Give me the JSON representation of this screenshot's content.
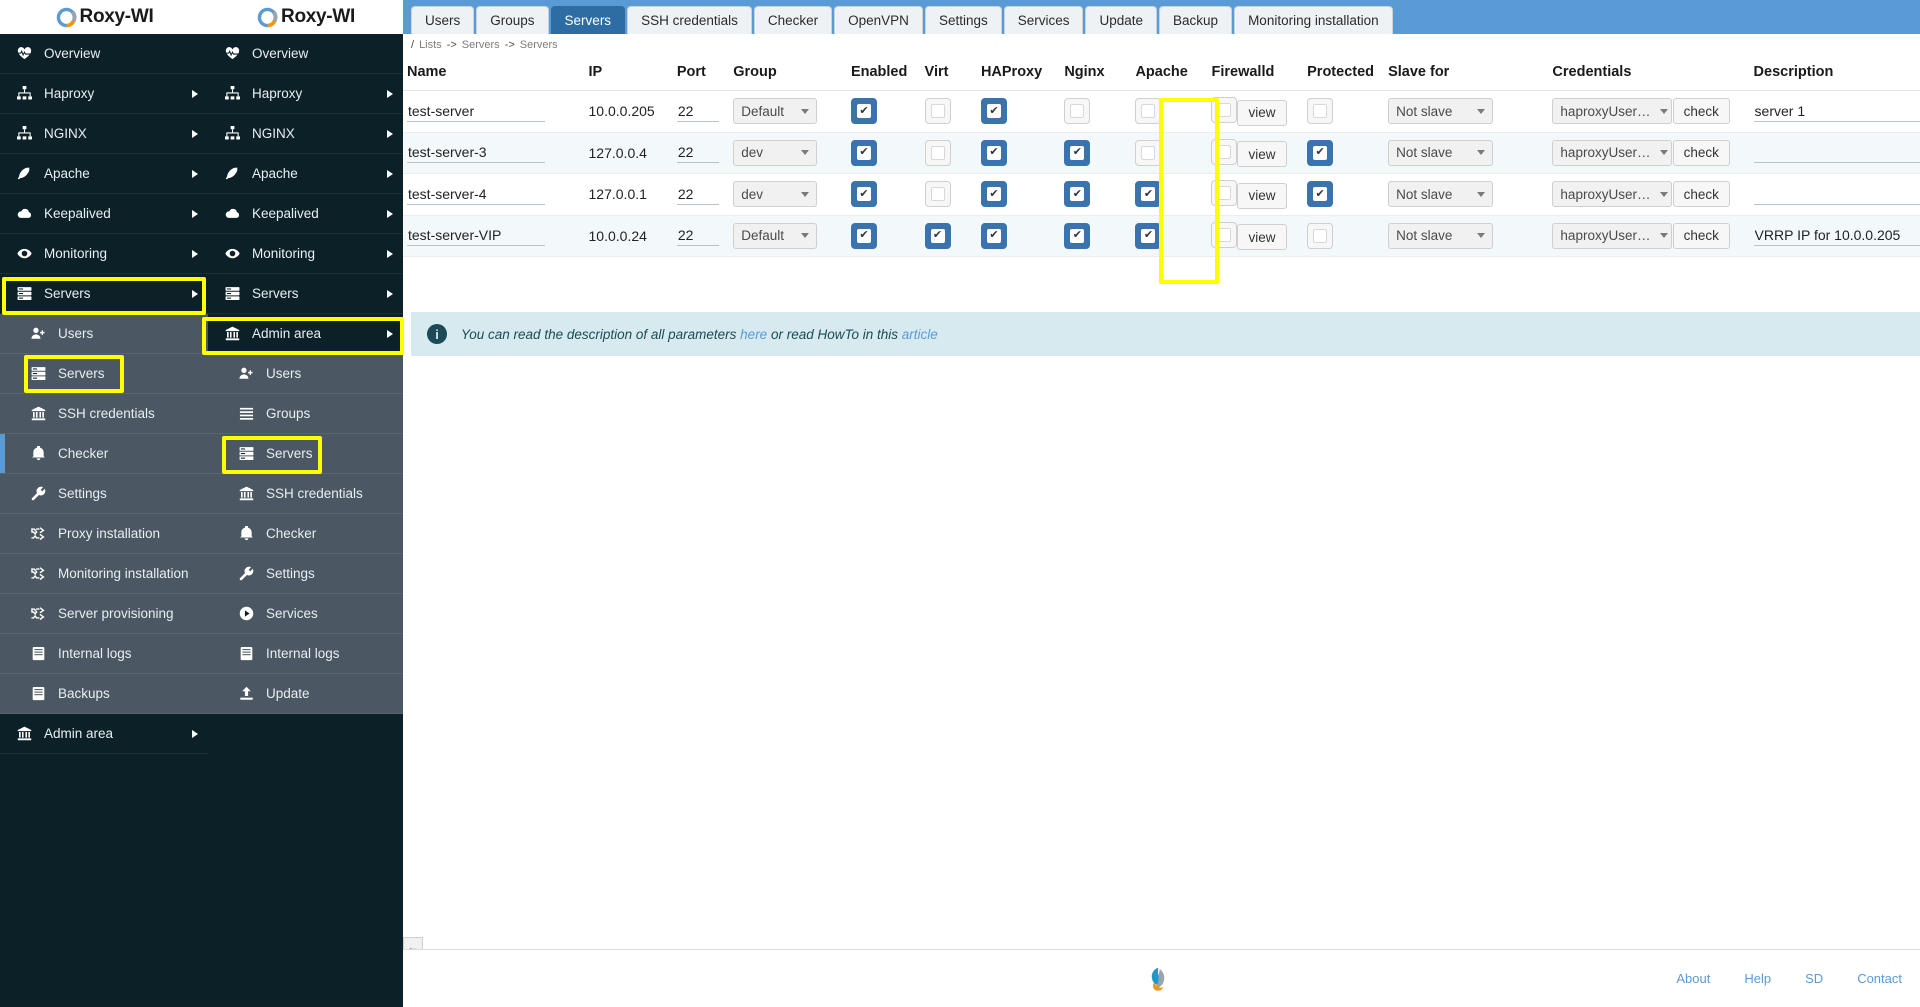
{
  "brand": {
    "name": "Roxy-WI"
  },
  "sidebar_primary": {
    "items": [
      {
        "label": "Overview",
        "icon": "heartbeat-icon",
        "expandable": false
      },
      {
        "label": "Haproxy",
        "icon": "sitemap-icon",
        "expandable": true
      },
      {
        "label": "NGINX",
        "icon": "sitemap-icon",
        "expandable": true
      },
      {
        "label": "Apache",
        "icon": "feather-icon",
        "expandable": true
      },
      {
        "label": "Keepalived",
        "icon": "cloud-icon",
        "expandable": true
      },
      {
        "label": "Monitoring",
        "icon": "eye-icon",
        "expandable": true
      },
      {
        "label": "Servers",
        "icon": "server-icon",
        "expandable": true,
        "highlighted": true
      }
    ],
    "sub_items": [
      {
        "label": "Users",
        "icon": "user-plus-icon"
      },
      {
        "label": "Servers",
        "icon": "server-icon",
        "highlighted": true
      },
      {
        "label": "SSH credentials",
        "icon": "bank-icon"
      },
      {
        "label": "Checker",
        "icon": "bell-icon",
        "active": true
      },
      {
        "label": "Settings",
        "icon": "wrench-icon"
      },
      {
        "label": "Proxy installation",
        "icon": "shuffle-icon"
      },
      {
        "label": "Monitoring installation",
        "icon": "shuffle-icon"
      },
      {
        "label": "Server provisioning",
        "icon": "shuffle-icon"
      },
      {
        "label": "Internal logs",
        "icon": "book-icon"
      },
      {
        "label": "Backups",
        "icon": "book-icon"
      }
    ],
    "trailing": [
      {
        "label": "Admin area",
        "icon": "bank-icon",
        "expandable": true
      }
    ]
  },
  "sidebar_secondary": {
    "items": [
      {
        "label": "Overview",
        "icon": "heartbeat-icon",
        "expandable": false
      },
      {
        "label": "Haproxy",
        "icon": "sitemap-icon",
        "expandable": true
      },
      {
        "label": "NGINX",
        "icon": "sitemap-icon",
        "expandable": true
      },
      {
        "label": "Apache",
        "icon": "feather-icon",
        "expandable": true
      },
      {
        "label": "Keepalived",
        "icon": "cloud-icon",
        "expandable": true
      },
      {
        "label": "Monitoring",
        "icon": "eye-icon",
        "expandable": true
      },
      {
        "label": "Servers",
        "icon": "server-icon",
        "expandable": true
      },
      {
        "label": "Admin area",
        "icon": "bank-icon",
        "expandable": true,
        "highlighted": true
      }
    ],
    "sub_items": [
      {
        "label": "Users",
        "icon": "user-plus-icon"
      },
      {
        "label": "Groups",
        "icon": "list-icon"
      },
      {
        "label": "Servers",
        "icon": "server-icon",
        "highlighted": true
      },
      {
        "label": "SSH credentials",
        "icon": "bank-icon"
      },
      {
        "label": "Checker",
        "icon": "bell-icon"
      },
      {
        "label": "Settings",
        "icon": "wrench-icon"
      },
      {
        "label": "Services",
        "icon": "play-circle-icon"
      },
      {
        "label": "Internal logs",
        "icon": "book-icon"
      },
      {
        "label": "Update",
        "icon": "upload-icon"
      }
    ]
  },
  "tabs": [
    {
      "label": "Users",
      "selected": false
    },
    {
      "label": "Groups",
      "selected": false
    },
    {
      "label": "Servers",
      "selected": true
    },
    {
      "label": "SSH credentials",
      "selected": false
    },
    {
      "label": "Checker",
      "selected": false
    },
    {
      "label": "OpenVPN",
      "selected": false
    },
    {
      "label": "Settings",
      "selected": false
    },
    {
      "label": "Services",
      "selected": false
    },
    {
      "label": "Update",
      "selected": false
    },
    {
      "label": "Backup",
      "selected": false
    },
    {
      "label": "Monitoring installation",
      "selected": false
    }
  ],
  "breadcrumb": {
    "root": "/",
    "items": [
      "Lists",
      "Servers",
      "Servers"
    ],
    "separator": "->"
  },
  "table": {
    "columns": [
      "Name",
      "IP",
      "Port",
      "Group",
      "Enabled",
      "Virt",
      "HAProxy",
      "Nginx",
      "Apache",
      "Firewalld",
      "Protected",
      "Slave for",
      "Credentials",
      "",
      "Description"
    ],
    "view_label": "view",
    "check_label": "check",
    "rows": [
      {
        "name": "test-server",
        "ip": "10.0.0.205",
        "port": "22",
        "group": "Default",
        "enabled": true,
        "virt": false,
        "haproxy": true,
        "nginx": false,
        "apache": false,
        "firewalld": false,
        "protected": false,
        "slave_for": "Not slave",
        "credentials": "haproxyUser…",
        "description": "server 1"
      },
      {
        "name": "test-server-3",
        "ip": "127.0.0.4",
        "port": "22",
        "group": "dev",
        "enabled": true,
        "virt": false,
        "haproxy": true,
        "nginx": true,
        "apache": false,
        "firewalld": false,
        "protected": true,
        "slave_for": "Not slave",
        "credentials": "haproxyUser…",
        "description": ""
      },
      {
        "name": "test-server-4",
        "ip": "127.0.0.1",
        "port": "22",
        "group": "dev",
        "enabled": true,
        "virt": false,
        "haproxy": true,
        "nginx": true,
        "apache": true,
        "firewalld": false,
        "protected": true,
        "slave_for": "Not slave",
        "credentials": "haproxyUser…",
        "description": ""
      },
      {
        "name": "test-server-VIP",
        "ip": "10.0.0.24",
        "port": "22",
        "group": "Default",
        "enabled": true,
        "virt": true,
        "haproxy": true,
        "nginx": true,
        "apache": true,
        "firewalld": false,
        "protected": false,
        "slave_for": "Not slave",
        "credentials": "haproxyUser…",
        "description": "VRRP IP for 10.0.0.205"
      }
    ]
  },
  "notice": {
    "text_before": "You can read the description of all parameters ",
    "link1": "here",
    "text_middle": " or read HowTo in this ",
    "link2": "article"
  },
  "footer": {
    "links": [
      "About",
      "Help",
      "SD",
      "Contact"
    ]
  },
  "collapse": {
    "glyph": "←"
  },
  "colors": {
    "tab_active": "#2d6da3",
    "tabbar": "#5b9bd5",
    "sidebar_bg": "#0c2028",
    "sidebar_sub_bg": "#4b5762",
    "checkbox_on": "#3b74ad",
    "highlight": "#ffff00",
    "notice_bg": "#d6eaef",
    "link": "#5b9bd5"
  }
}
